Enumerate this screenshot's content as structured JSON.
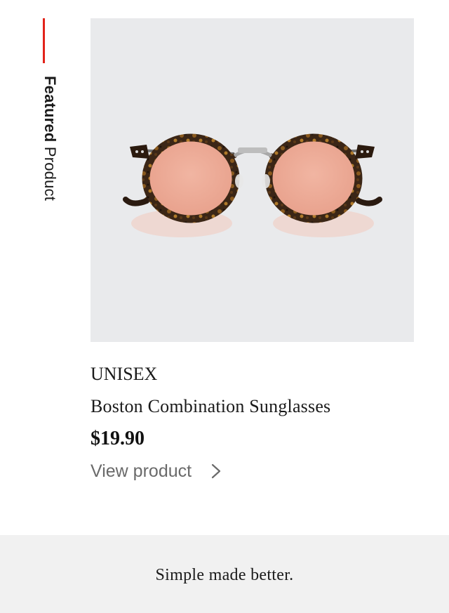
{
  "section_label": {
    "strong": "Featured",
    "light": "Product"
  },
  "product": {
    "image_subject": "sunglasses-icon",
    "category": "UNISEX",
    "name": "Boston Combination Sunglasses",
    "price": "$19.90",
    "link_label": "View product"
  },
  "footer": {
    "tagline": "Simple made better."
  },
  "colors": {
    "accent": "#e2231a",
    "image_bg": "#e9eaec",
    "footer_bg": "#f1f1f1",
    "link_text": "#6a6a6a"
  }
}
